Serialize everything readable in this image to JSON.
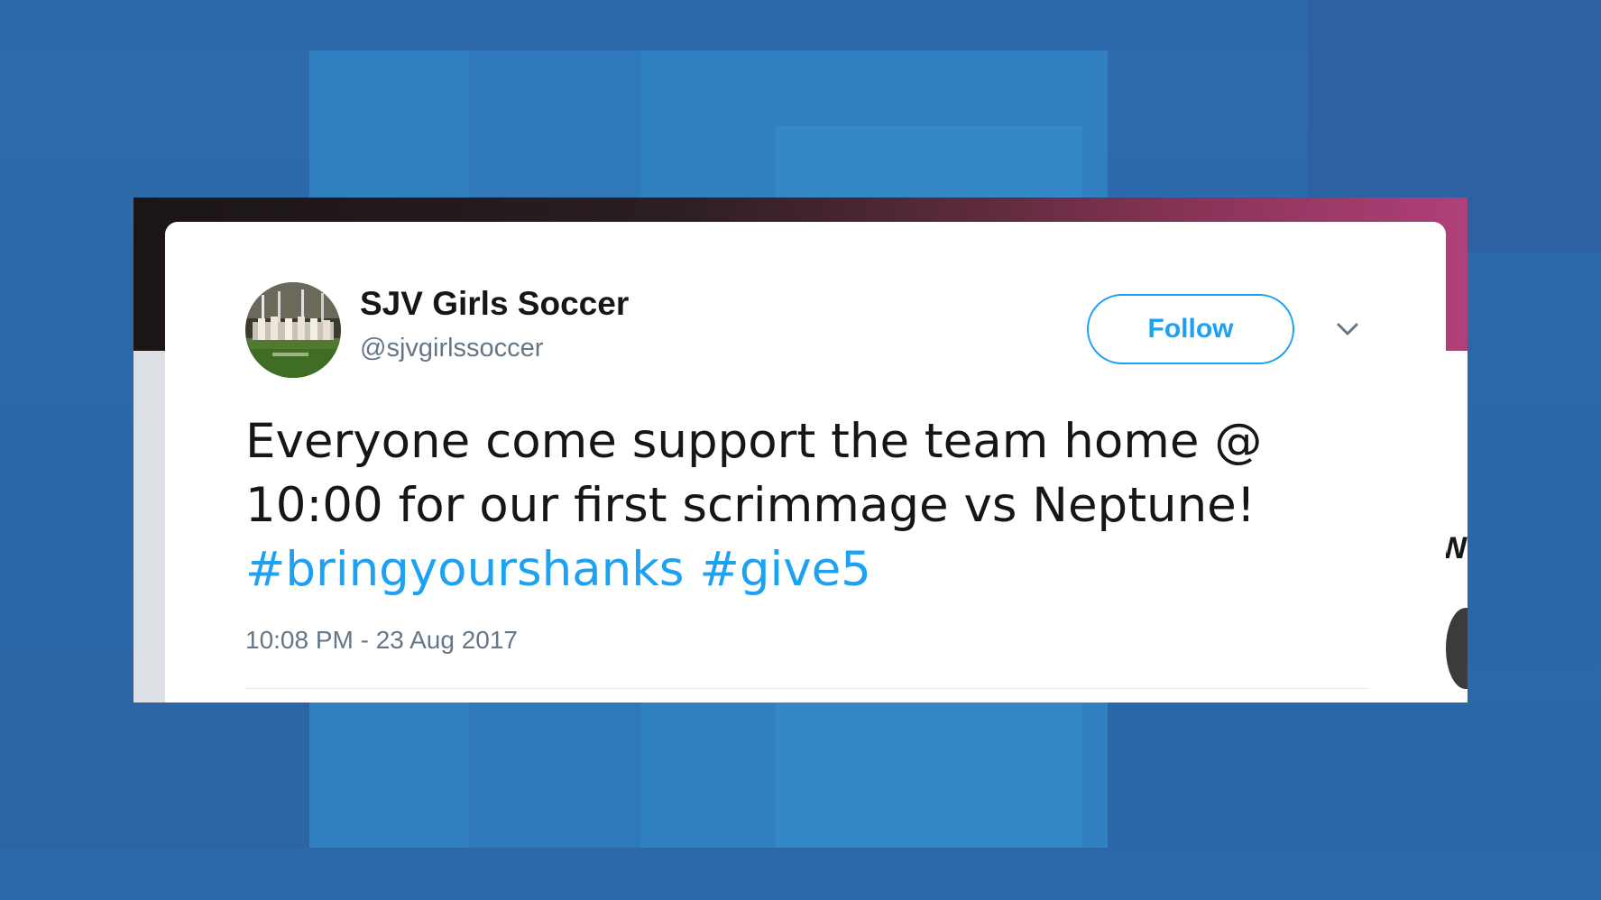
{
  "tweet": {
    "display_name": "SJV Girls Soccer",
    "handle": "@sjvgirlssoccer",
    "follow_label": "Follow",
    "text": "Everyone come support the team home @ 10:00 for our first scrimmage vs Neptune!",
    "hashtags": [
      "#bringyourshanks",
      "#give5"
    ],
    "timestamp": "10:08 PM - 23 Aug 2017"
  },
  "colors": {
    "link_blue": "#1da1f2",
    "name_text": "#14171a",
    "secondary_text": "#657786",
    "background_blue": "#2f78bb"
  },
  "icons": {
    "menu": "chevron-down-icon",
    "avatar": "team-photo-avatar"
  }
}
